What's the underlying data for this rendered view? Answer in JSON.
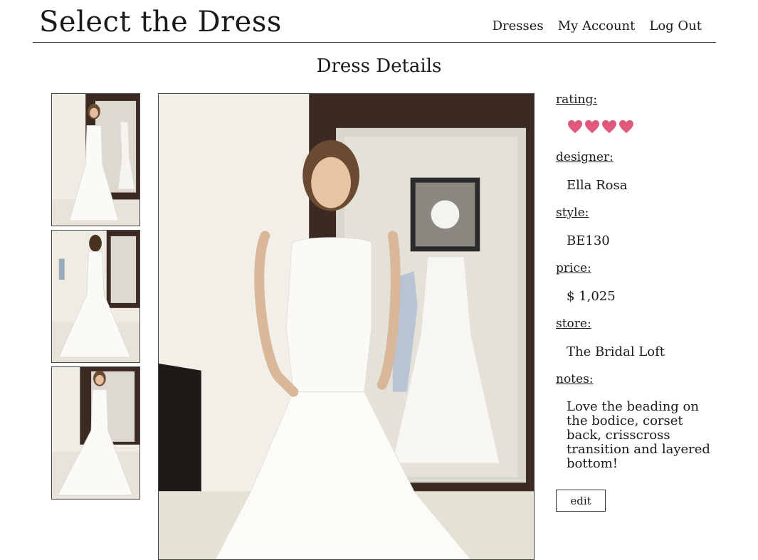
{
  "site": {
    "title": "Select the Dress"
  },
  "nav": {
    "items": [
      "Dresses",
      "My Account",
      "Log Out"
    ]
  },
  "page": {
    "heading": "Dress Details"
  },
  "details": {
    "rating_label": "rating:",
    "rating_value": 4,
    "rating_max": 4,
    "heart_color": "#e05a7a",
    "designer_label": "designer:",
    "designer": "Ella Rosa",
    "style_label": "style:",
    "style": "BE130",
    "price_label": "price:",
    "price": "$ 1,025",
    "store_label": "store:",
    "store": "The Bridal Loft",
    "notes_label": "notes:",
    "notes": "Love the beading on the bodice, corset back, crisscross transition and layered bottom!",
    "edit_label": "edit"
  }
}
